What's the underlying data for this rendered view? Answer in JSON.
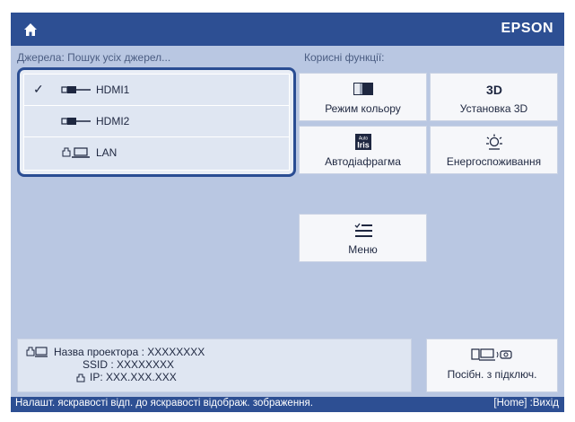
{
  "header": {
    "brand": "EPSON",
    "home_icon": "home-icon"
  },
  "sources": {
    "label": "Джерела: Пошук усіх джерел...",
    "items": [
      {
        "label": "HDMI1",
        "icon": "hdmi-icon",
        "selected": true
      },
      {
        "label": "HDMI2",
        "icon": "hdmi-icon",
        "selected": false
      },
      {
        "label": "LAN",
        "icon": "lan-icon",
        "selected": false
      }
    ]
  },
  "functions": {
    "label": "Корисні функції:",
    "tiles": [
      {
        "label": "Режим кольору",
        "icon": "color-mode-icon"
      },
      {
        "label": "Установка 3D",
        "icon": "3d-icon"
      },
      {
        "label": "Автодіафрагма",
        "icon": "auto-iris-icon"
      },
      {
        "label": "Енергоспоживання",
        "icon": "power-consumption-icon"
      },
      {
        "label": "Меню",
        "icon": "menu-icon"
      }
    ]
  },
  "network_info": {
    "projector_name": "Назва проектора : XXXXXXXX",
    "ssid": "SSID : XXXXXXXX",
    "ip": "IP: XXX.XXX.XXX"
  },
  "connection_guide": {
    "label": "Посібн. з підключ.",
    "icon": "connection-guide-icon"
  },
  "footer": {
    "hint": "Налашт. яскравості відп. до яскравості відображ. зображення.",
    "exit": "[Home] :Вихід"
  },
  "colors": {
    "bar": "#2d4f93",
    "background": "#b9c7e2",
    "tile": "#f6f7fa"
  },
  "auto_iris_icon_text": {
    "top": "Auto",
    "bottom": "Iris"
  },
  "3d_icon_text": "3D"
}
